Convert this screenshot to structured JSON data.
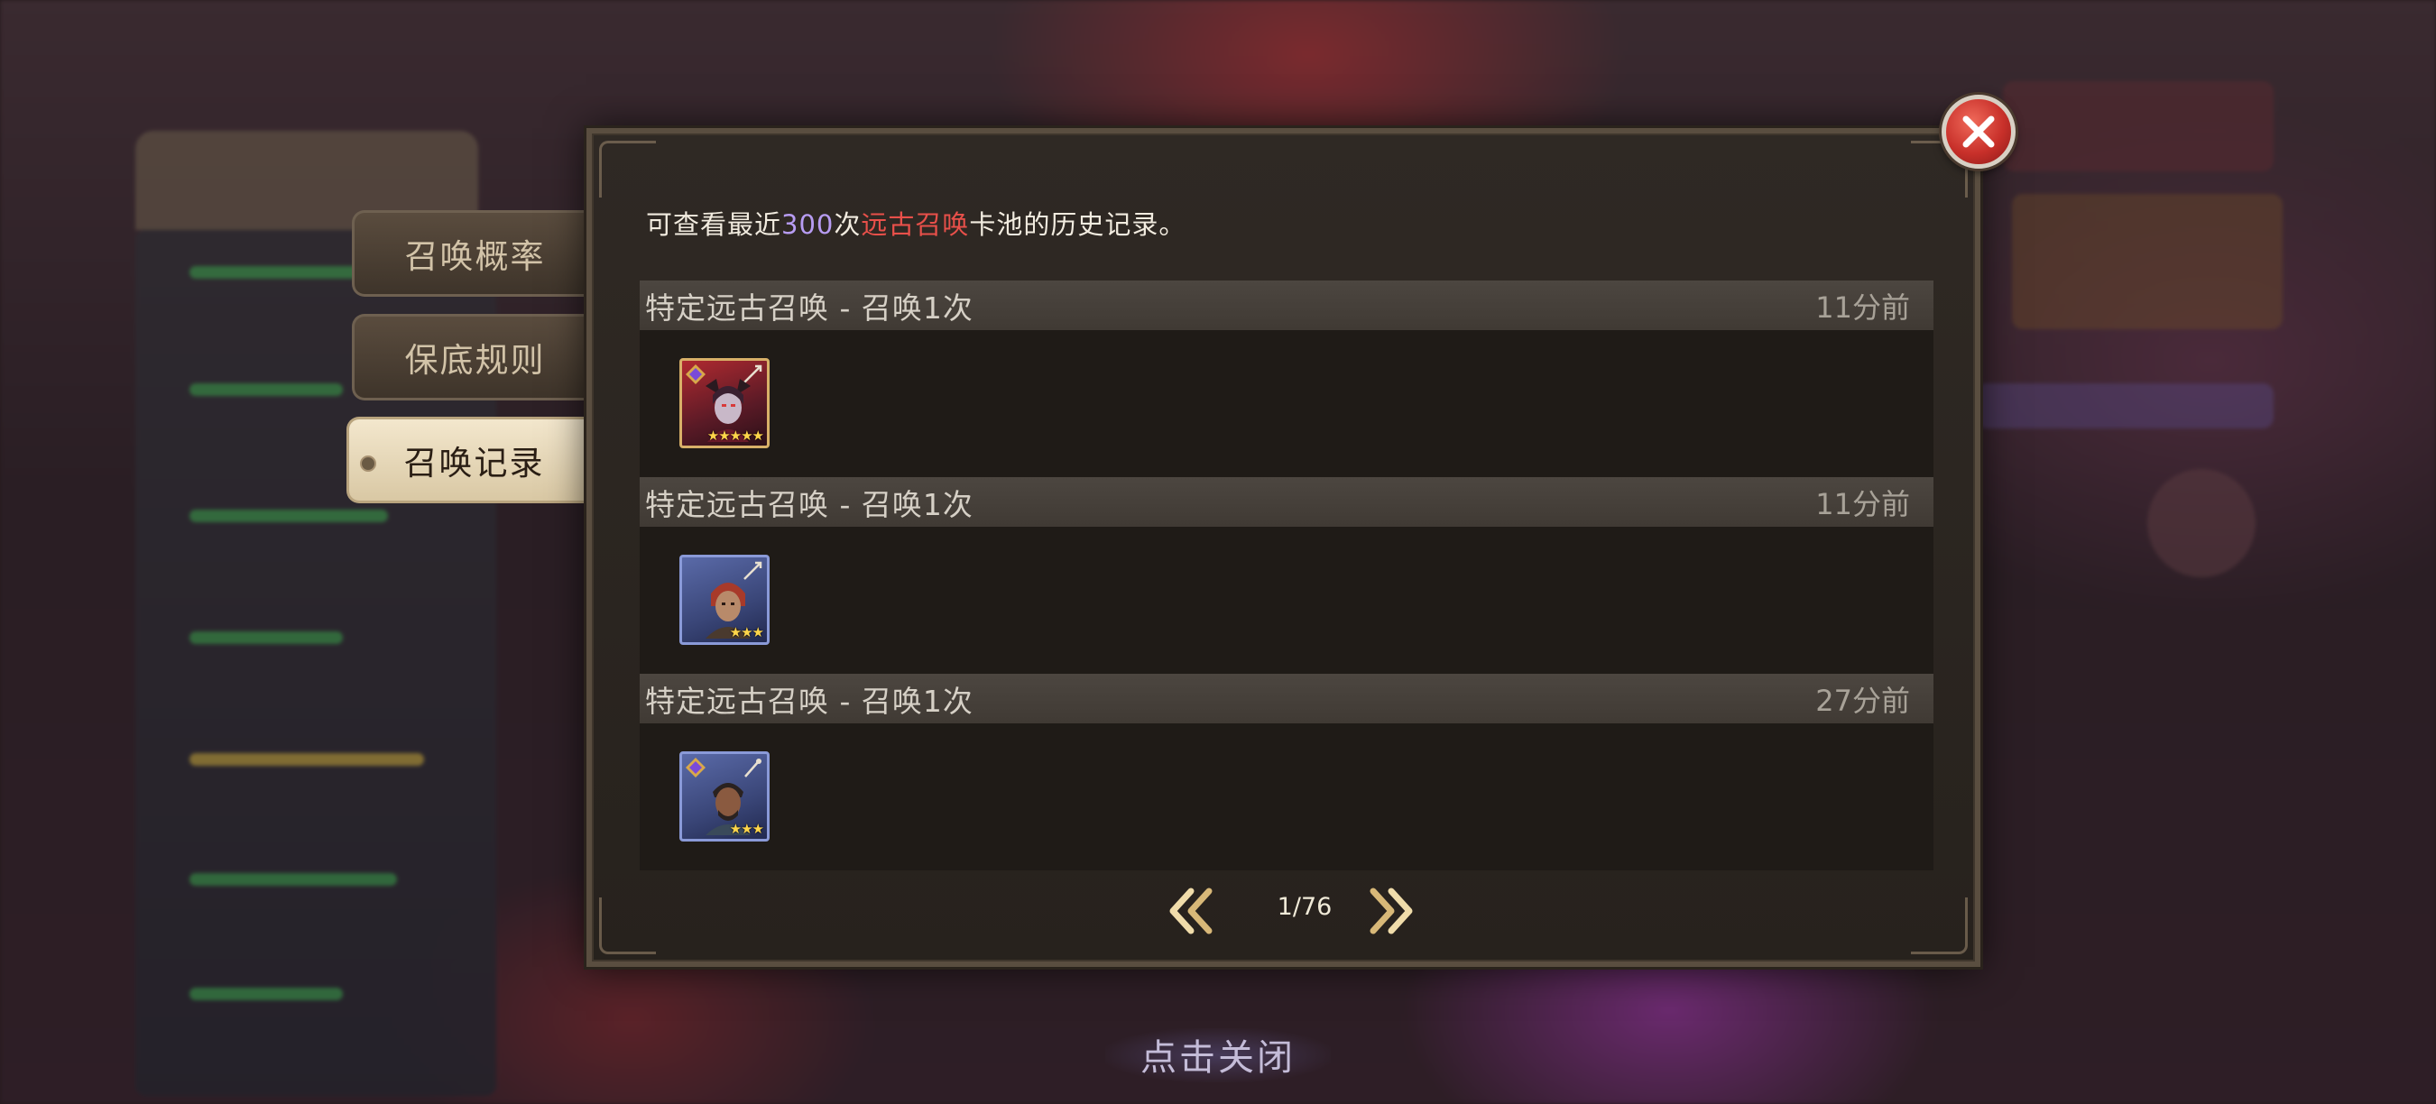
{
  "tabs": [
    {
      "label": "召唤概率",
      "active": false
    },
    {
      "label": "保底规则",
      "active": false
    },
    {
      "label": "召唤记录",
      "active": true
    }
  ],
  "dialog": {
    "info": {
      "prefix": "可查看最近",
      "count": "300",
      "middle": "次",
      "pool_name": "远古召唤",
      "suffix": "卡池的历史记录。"
    },
    "records": [
      {
        "title": "特定远古召唤 - 召唤1次",
        "time": "11分前",
        "hero": {
          "rarity": "epic",
          "stars": "★★★★★",
          "stars_count": 5
        }
      },
      {
        "title": "特定远古召唤 - 召唤1次",
        "time": "11分前",
        "hero": {
          "rarity": "rare",
          "stars": "★★★",
          "stars_count": 3
        }
      },
      {
        "title": "特定远古召唤 - 召唤1次",
        "time": "27分前",
        "hero": {
          "rarity": "rare",
          "stars": "★★★",
          "stars_count": 3
        }
      }
    ],
    "pager": {
      "label": "1/76",
      "current": 1,
      "total": 76
    }
  },
  "footer": {
    "tap_to_close": "点击关闭"
  },
  "colors": {
    "accent_count": "#b79cf2",
    "accent_pool": "#e8504a",
    "close_button": "#c8302a"
  }
}
